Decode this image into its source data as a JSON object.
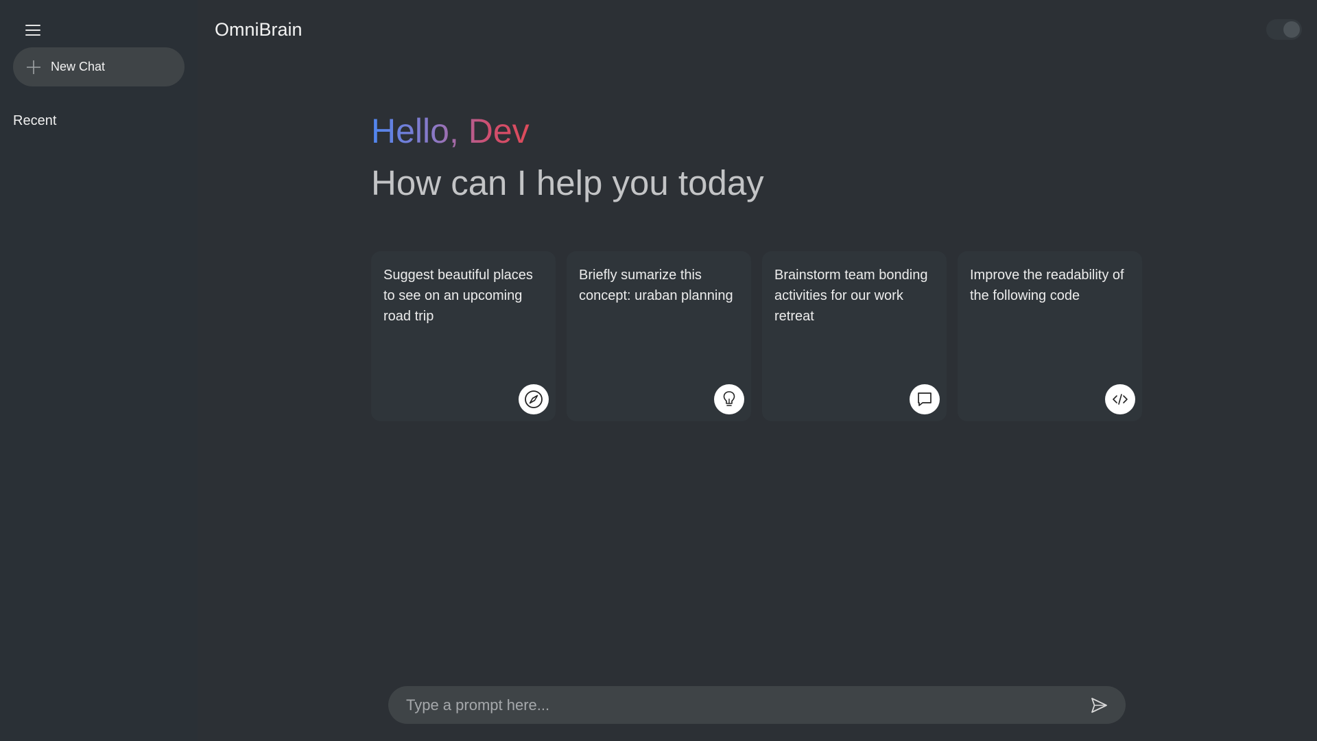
{
  "app": {
    "title": "OmniBrain"
  },
  "sidebar": {
    "new_chat_label": "New Chat",
    "recent_label": "Recent"
  },
  "greeting": {
    "hello": "Hello, Dev",
    "subheading": "How can I help you today"
  },
  "cards": [
    {
      "text": "Suggest beautiful places to see on an upcoming road trip",
      "icon": "compass-icon"
    },
    {
      "text": "Briefly sumarize this concept: uraban planning",
      "icon": "lightbulb-icon"
    },
    {
      "text": "Brainstorm team bonding activities for our work retreat",
      "icon": "chat-bubble-icon"
    },
    {
      "text": "Improve the readability of the following code",
      "icon": "code-icon"
    }
  ],
  "prompt": {
    "placeholder": "Type a prompt here...",
    "value": ""
  },
  "colors": {
    "background": "#2c3035",
    "sidebar": "#2a3036",
    "card": "#2f353a",
    "pill": "#3f4447",
    "greeting_gradient": [
      "#4f86f0",
      "#8c79c6",
      "#d04e6e",
      "#dd4b5a"
    ],
    "subheading": "#c3c4c6"
  }
}
